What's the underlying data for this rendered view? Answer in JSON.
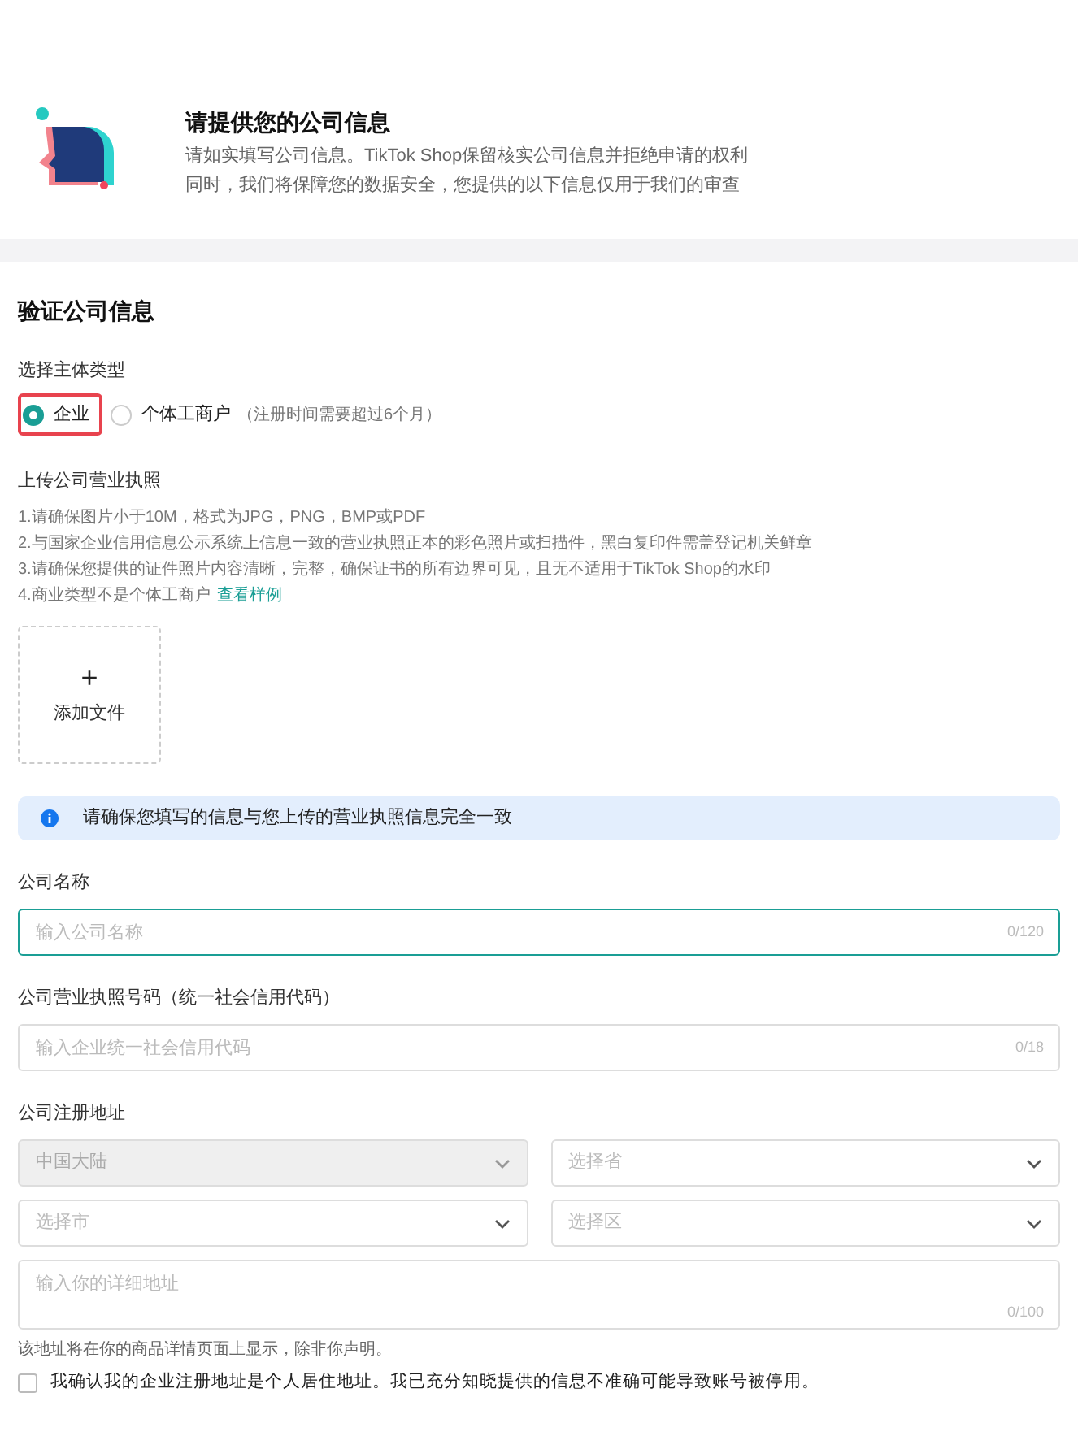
{
  "header": {
    "title": "请提供您的公司信息",
    "lines": [
      "请如实填写公司信息。TikTok Shop保留核实公司信息并拒绝申请的权利",
      "同时，我们将保障您的数据安全，您提供的以下信息仅用于我们的审查"
    ]
  },
  "section_title": "验证公司信息",
  "entity_type": {
    "label": "选择主体类型",
    "options": [
      {
        "label": "企业",
        "selected": true,
        "highlighted": true
      },
      {
        "label": "个体工商户",
        "note": "（注册时间需要超过6个月）",
        "selected": false,
        "highlighted": false
      }
    ]
  },
  "upload": {
    "label": "上传公司营业执照",
    "rules": [
      "1.请确保图片小于10M，格式为JPG，PNG，BMP或PDF",
      "2.与国家企业信用信息公示系统上信息一致的营业执照正本的彩色照片或扫描件，黑白复印件需盖登记机关鲜章",
      "3.请确保您提供的证件照片内容清晰，完整，确保证书的所有边界可见，且无不适用于TikTok Shop的水印",
      "4.商业类型不是个体工商户"
    ],
    "sample_link": "查看样例",
    "button_icon": "+",
    "button_label": "添加文件"
  },
  "notice": "请确保您填写的信息与您上传的营业执照信息完全一致",
  "company_name": {
    "label": "公司名称",
    "placeholder": "输入公司名称",
    "counter": "0/120",
    "focused": true
  },
  "license_number": {
    "label": "公司营业执照号码（统一社会信用代码）",
    "placeholder": "输入企业统一社会信用代码",
    "counter": "0/18",
    "focused": false
  },
  "address": {
    "label": "公司注册地址",
    "selects": [
      {
        "value": "中国大陆",
        "disabled": true
      },
      {
        "placeholder": "选择省",
        "disabled": false
      },
      {
        "placeholder": "选择市",
        "disabled": false
      },
      {
        "placeholder": "选择区",
        "disabled": false
      }
    ],
    "detail": {
      "placeholder": "输入你的详细地址",
      "counter": "0/100"
    },
    "hint": "该地址将在你的商品详情页面上显示，除非你声明。"
  },
  "confirm": {
    "label": "我确认我的企业注册地址是个人居住地址。我已充分知晓提供的信息不准确可能导致账号被停用。",
    "checked": false
  }
}
